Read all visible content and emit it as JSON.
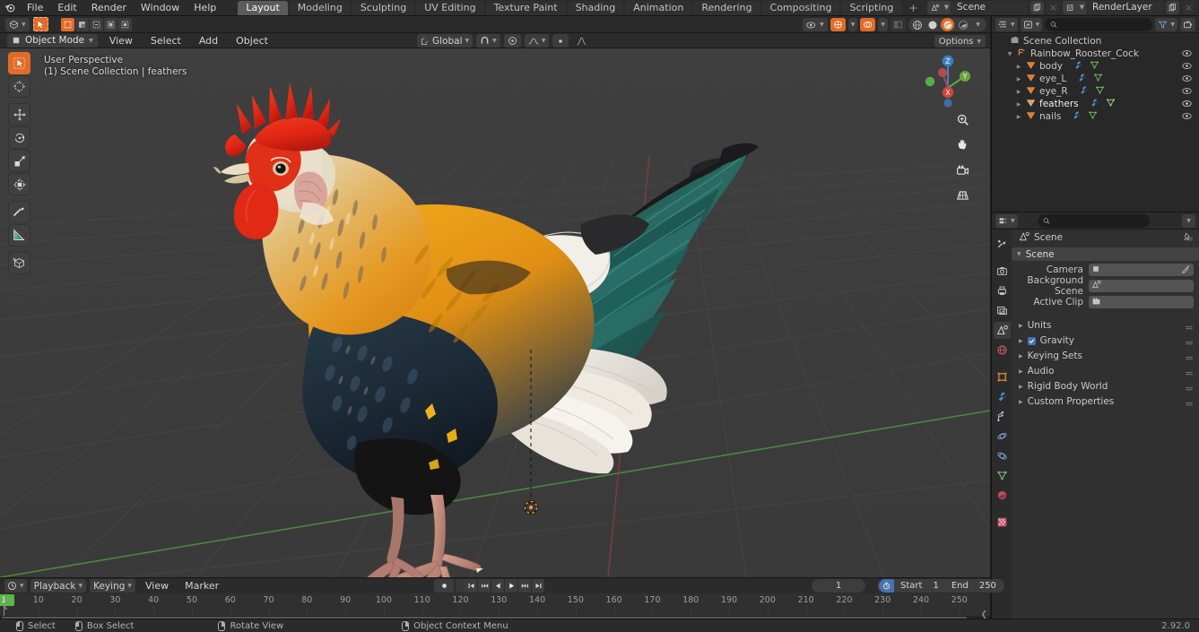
{
  "app": {
    "name": "Blender",
    "version": "2.92.0"
  },
  "topbar": {
    "logo_icon": "blender-logo-icon",
    "menus": [
      "File",
      "Edit",
      "Render",
      "Window",
      "Help"
    ],
    "workspace_tabs": [
      {
        "label": "Layout",
        "active": true
      },
      {
        "label": "Modeling",
        "active": false
      },
      {
        "label": "Sculpting",
        "active": false
      },
      {
        "label": "UV Editing",
        "active": false
      },
      {
        "label": "Texture Paint",
        "active": false
      },
      {
        "label": "Shading",
        "active": false
      },
      {
        "label": "Animation",
        "active": false
      },
      {
        "label": "Rendering",
        "active": false
      },
      {
        "label": "Compositing",
        "active": false
      },
      {
        "label": "Scripting",
        "active": false
      }
    ],
    "add_workspace_label": "+",
    "scene_name": "Scene",
    "view_layer_name": "RenderLayer",
    "scene_icon": "scene-icon",
    "viewlayer_icon": "view-layer-icon",
    "new_icon": "new-copy-icon",
    "unlink_icon": "unlink-x-icon"
  },
  "viewport": {
    "editor_type_icon": "editor-type-3dview-icon",
    "mode": "Object Mode",
    "mode_icon": "object-mode-icon",
    "menus": [
      "View",
      "Select",
      "Add",
      "Object"
    ],
    "transform_orientation": "Global",
    "transform_orientation_icon": "orientation-icon",
    "snap_icon": "magnet-icon",
    "proportional_icon": "proportional-edit-icon",
    "proportional_falloff_icon": "falloff-smooth-icon",
    "options_label": "Options",
    "overlay_header": "User Perspective",
    "overlay_subtext": "(1) Scene Collection | feathers",
    "tools": [
      {
        "name": "tweak-select-tool",
        "icon": "cursor-arrow-icon",
        "active": true
      },
      {
        "name": "cursor-tool",
        "icon": "3d-cursor-icon",
        "active": false
      },
      {
        "name": "move-tool",
        "icon": "move-arrows-icon",
        "active": false
      },
      {
        "name": "rotate-tool",
        "icon": "rotate-icon",
        "active": false
      },
      {
        "name": "scale-tool",
        "icon": "scale-icon",
        "active": false
      },
      {
        "name": "transform-tool",
        "icon": "transform-icon",
        "active": false
      },
      {
        "name": "annotate-tool",
        "icon": "pencil-annotate-icon",
        "active": false
      },
      {
        "name": "measure-tool",
        "icon": "ruler-measure-icon",
        "active": false
      },
      {
        "name": "add-cube-tool",
        "icon": "add-cube-icon",
        "active": false
      }
    ],
    "gizmo_axes": [
      "X",
      "Y",
      "Z"
    ],
    "nav_buttons": [
      {
        "name": "zoom-view-button",
        "icon": "magnifier-icon"
      },
      {
        "name": "pan-view-button",
        "icon": "hand-icon"
      },
      {
        "name": "camera-view-button",
        "icon": "camera-icon"
      },
      {
        "name": "toggle-ortho-button",
        "icon": "grid-perspective-icon"
      }
    ],
    "shading_buttons": [
      {
        "name": "visibility-selector",
        "icon": "eye-dropdown-icon"
      },
      {
        "name": "gizmo-toggle",
        "icon": "gizmo-icon",
        "active": true
      },
      {
        "name": "overlays-toggle",
        "icon": "overlays-icon",
        "active": true
      },
      {
        "name": "xray-toggle",
        "icon": "xray-icon",
        "active": false
      },
      {
        "name": "shading-wireframe",
        "icon": "wireframe-sphere-icon",
        "active": false
      },
      {
        "name": "shading-solid",
        "icon": "solid-sphere-icon",
        "active": false
      },
      {
        "name": "shading-material",
        "icon": "material-sphere-icon",
        "active": true
      },
      {
        "name": "shading-rendered",
        "icon": "rendered-sphere-icon",
        "active": false
      }
    ]
  },
  "outliner": {
    "display_mode_icon": "outliner-display-mode-icon",
    "filter_id_icon": "filter-id-icon",
    "search_placeholder": "",
    "search_value": "",
    "filter_icon": "funnel-filter-icon",
    "new_collection_icon": "new-collection-icon",
    "root": {
      "label": "Scene Collection",
      "icon": "collection-icon"
    },
    "items": [
      {
        "label": "Rainbow_Rooster_Cock",
        "icon": "armature-empty-icon",
        "depth": 1,
        "expanded": true,
        "visible": true,
        "modifiers": []
      },
      {
        "label": "body",
        "icon": "mesh-data-icon",
        "depth": 2,
        "expanded": false,
        "visible": true,
        "modifiers": [
          "modifier-wrench-icon",
          "mesh-triangle-icon"
        ]
      },
      {
        "label": "eye_L",
        "icon": "mesh-data-icon",
        "depth": 2,
        "expanded": false,
        "visible": true,
        "modifiers": [
          "modifier-wrench-icon",
          "mesh-triangle-icon"
        ]
      },
      {
        "label": "eye_R",
        "icon": "mesh-data-icon",
        "depth": 2,
        "expanded": false,
        "visible": true,
        "modifiers": [
          "modifier-wrench-icon",
          "mesh-triangle-icon"
        ]
      },
      {
        "label": "feathers",
        "icon": "mesh-data-icon",
        "depth": 2,
        "expanded": false,
        "visible": true,
        "selected": true,
        "modifiers": [
          "modifier-wrench-icon",
          "mesh-triangle-icon"
        ]
      },
      {
        "label": "nails",
        "icon": "mesh-data-icon",
        "depth": 2,
        "expanded": false,
        "visible": true,
        "modifiers": [
          "modifier-wrench-icon",
          "mesh-triangle-icon"
        ]
      }
    ]
  },
  "properties": {
    "editor_type_icon": "editor-type-properties-icon",
    "search_placeholder": "",
    "search_value": "",
    "options_icon": "chevron-down-icon",
    "breadcrumb": "Scene",
    "breadcrumb_icon": "scene-properties-icon",
    "pin_icon": "pin-icon",
    "tabs": [
      {
        "name": "tool-tab",
        "icon": "tool-screwdriver-icon",
        "active": false
      },
      {
        "name": "render-tab",
        "icon": "render-camera-back-icon",
        "active": false
      },
      {
        "name": "output-tab",
        "icon": "output-printer-icon",
        "active": false
      },
      {
        "name": "view-layer-tab",
        "icon": "view-layer-images-icon",
        "active": false
      },
      {
        "name": "scene-tab",
        "icon": "scene-cone-icon",
        "active": true
      },
      {
        "name": "world-tab",
        "icon": "world-globe-icon",
        "active": false
      },
      {
        "name": "object-tab",
        "icon": "object-square-icon",
        "active": false
      },
      {
        "name": "modifier-tab",
        "icon": "modifier-wrench-icon",
        "active": false
      },
      {
        "name": "particles-tab",
        "icon": "particles-icon",
        "active": false
      },
      {
        "name": "physics-tab",
        "icon": "physics-orbit-icon",
        "active": false
      },
      {
        "name": "constraints-tab",
        "icon": "constraints-icon",
        "active": false
      },
      {
        "name": "data-tab",
        "icon": "object-data-triangle-icon",
        "active": false
      },
      {
        "name": "material-tab",
        "icon": "material-sphere-icon",
        "active": false
      },
      {
        "name": "texture-tab",
        "icon": "texture-checker-icon",
        "active": false
      }
    ],
    "scene_panel": {
      "title": "Scene",
      "expanded": true,
      "rows": [
        {
          "label": "Camera",
          "value": "",
          "icon": "camera-object-icon",
          "eyedropper": true
        },
        {
          "label": "Background Scene",
          "value": "",
          "icon": "scene-icon",
          "eyedropper": false
        },
        {
          "label": "Active Clip",
          "value": "",
          "icon": "movie-clip-icon",
          "eyedropper": false
        }
      ]
    },
    "sub_panels": [
      {
        "label": "Units",
        "checkbox": null,
        "expanded": false
      },
      {
        "label": "Gravity",
        "checkbox": true,
        "expanded": false
      },
      {
        "label": "Keying Sets",
        "checkbox": null,
        "expanded": false
      },
      {
        "label": "Audio",
        "checkbox": null,
        "expanded": false
      },
      {
        "label": "Rigid Body World",
        "checkbox": null,
        "expanded": false
      },
      {
        "label": "Custom Properties",
        "checkbox": null,
        "expanded": false
      }
    ]
  },
  "timeline": {
    "editor_type_icon": "editor-type-timeline-icon",
    "menus": [
      "Playback",
      "Keying",
      "View",
      "Marker"
    ],
    "menus_with_dropdown": [
      "Playback",
      "Keying"
    ],
    "record_icon": "record-keyframe-icon",
    "transport": [
      {
        "name": "jump-to-start-button",
        "icon": "jump-start-icon"
      },
      {
        "name": "jump-to-prev-keyframe-button",
        "icon": "prev-keyframe-icon"
      },
      {
        "name": "play-reverse-button",
        "icon": "play-reverse-icon"
      },
      {
        "name": "play-button",
        "icon": "play-icon"
      },
      {
        "name": "jump-to-next-keyframe-button",
        "icon": "next-keyframe-icon"
      },
      {
        "name": "jump-to-end-button",
        "icon": "jump-end-icon"
      }
    ],
    "current_frame": "1",
    "current_frame_marker": "1",
    "use_preview_range_icon": "stopwatch-icon",
    "start_label": "Start",
    "start_value": "1",
    "end_label": "End",
    "end_value": "250",
    "ruler_ticks": [
      10,
      20,
      30,
      40,
      50,
      60,
      70,
      80,
      90,
      100,
      110,
      120,
      130,
      140,
      150,
      160,
      170,
      180,
      190,
      200,
      210,
      220,
      230,
      240,
      250
    ],
    "ruler_range": [
      0,
      258
    ]
  },
  "statusbar": {
    "hints": [
      {
        "icon": "mouse-left-icon",
        "label": "Select"
      },
      {
        "icon": "mouse-left-drag-icon",
        "label": "Box Select"
      },
      {
        "icon": "mouse-middle-icon",
        "label": "Rotate View"
      },
      {
        "icon": "mouse-right-icon",
        "label": "Object Context Menu"
      }
    ],
    "version": "2.92.0"
  },
  "colors": {
    "accent_orange": "#e06c28",
    "accent_blue": "#4772b3",
    "green_playhead": "#5bb54a",
    "viewport_bg": "#3d3d3d",
    "header_bg": "#2b2b2b",
    "panel_bg": "#303030",
    "outliner_bg": "#282828",
    "axis_x_red": "#c4465c",
    "axis_y_green": "#5fa83f"
  }
}
